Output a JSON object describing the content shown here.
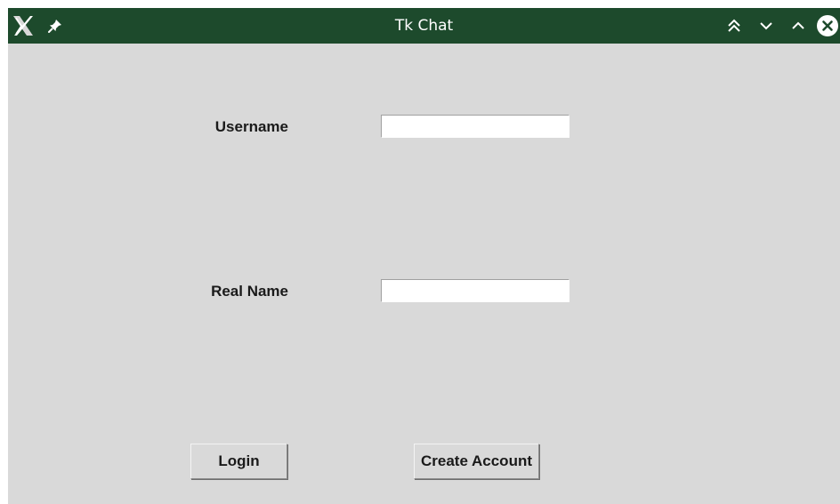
{
  "window": {
    "title": "Tk Chat",
    "icons": {
      "app": "x-window-system-icon",
      "pin": "pin-icon",
      "shade": "double-chevron-up-icon",
      "minimize": "chevron-down-icon",
      "maximize": "chevron-up-icon",
      "close": "close-circle-icon"
    },
    "colors": {
      "titlebar": "#1d4a2c",
      "background": "#d9d9d9"
    }
  },
  "form": {
    "username_label": "Username",
    "username_value": "",
    "realname_label": "Real Name",
    "realname_value": ""
  },
  "actions": {
    "login_label": "Login",
    "create_account_label": "Create Account"
  }
}
